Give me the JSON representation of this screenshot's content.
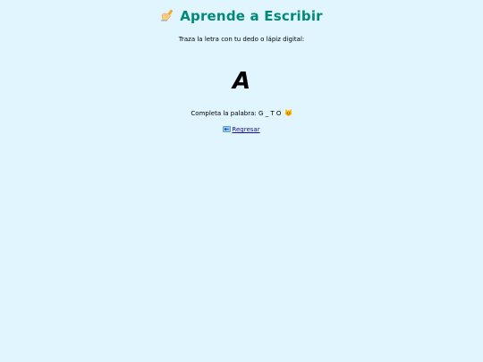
{
  "header": {
    "title": "Aprende a Escribir",
    "title_icon": "writing-hand-icon"
  },
  "instruction": "Traza la letra con tu dedo o lápiz digital:",
  "letter": "A",
  "word_task": {
    "text": "Completa la palabra: G _ T O",
    "icon": "cat-face-icon"
  },
  "back_link": {
    "label": "Regresar",
    "icon": "back-arrow-icon"
  },
  "colors": {
    "background": "#e1f5fe",
    "title": "#00897b",
    "link": "#1a0dab"
  }
}
